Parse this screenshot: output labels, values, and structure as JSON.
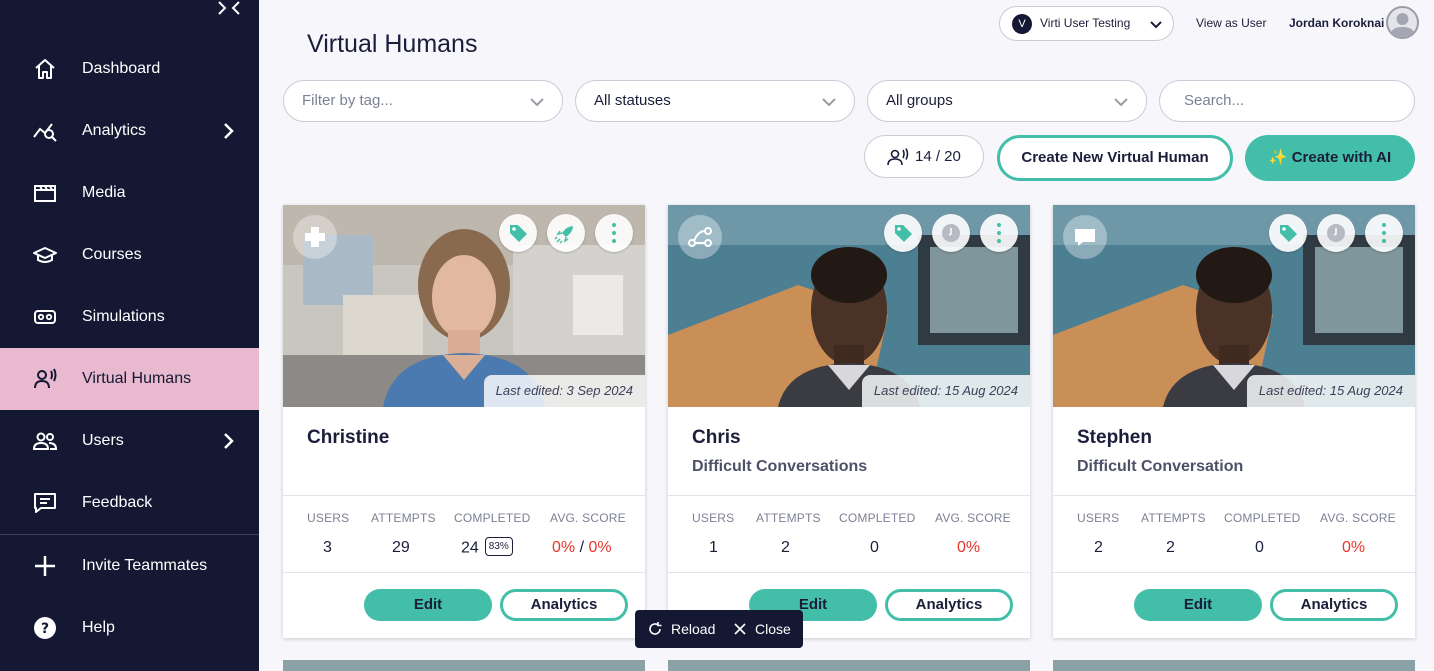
{
  "sidebar": {
    "items": [
      {
        "label": "Dashboard",
        "icon": "home-icon",
        "active": false,
        "expandable": false
      },
      {
        "label": "Analytics",
        "icon": "analytics-icon",
        "active": false,
        "expandable": true
      },
      {
        "label": "Media",
        "icon": "clapperboard-icon",
        "active": false,
        "expandable": false
      },
      {
        "label": "Courses",
        "icon": "graduation-cap-icon",
        "active": false,
        "expandable": false
      },
      {
        "label": "Simulations",
        "icon": "vr-headset-icon",
        "active": false,
        "expandable": false
      },
      {
        "label": "Virtual Humans",
        "icon": "speaking-person-icon",
        "active": true,
        "expandable": false
      },
      {
        "label": "Users",
        "icon": "users-icon",
        "active": false,
        "expandable": true
      },
      {
        "label": "Feedback",
        "icon": "chat-box-icon",
        "active": false,
        "expandable": false
      }
    ],
    "bottom_items": [
      {
        "label": "Invite Teammates",
        "icon": "plus-icon"
      },
      {
        "label": "Help",
        "icon": "help-icon"
      }
    ],
    "colors": {
      "background": "#141833",
      "active": "#e9b9cf"
    }
  },
  "header": {
    "title": "Virtual Humans",
    "org_logo_letter": "V",
    "org_name": "Virti User Testing",
    "view_as": "View as User",
    "user_name": "Jordan Koroknai"
  },
  "filters": {
    "tag_placeholder": "Filter by tag...",
    "status": "All statuses",
    "group": "All groups",
    "search_placeholder": "Search..."
  },
  "actions": {
    "seat_count": "14 / 20",
    "create_label": "Create New Virtual Human",
    "create_ai_label": "✨ Create with AI",
    "accent": "#43bfa9"
  },
  "stat_labels": {
    "users": "USERS",
    "attempts": "ATTEMPTS",
    "completed": "COMPLETED",
    "avg_score": "AVG. SCORE"
  },
  "cards": [
    {
      "name": "Christine",
      "subtitle": "",
      "type_icon": "medical-cross-icon",
      "status_icon": "rocket-icon",
      "last_edited": "Last edited:  3 Sep 2024",
      "users": "3",
      "attempts": "29",
      "completed": "24",
      "completed_pct": "83%",
      "avg_score_a": "0%",
      "avg_score_sep": "/",
      "avg_score_b": "0%",
      "edit_label": "Edit",
      "analytics_label": "Analytics"
    },
    {
      "name": "Chris",
      "subtitle": "Difficult Conversations",
      "type_icon": "branching-icon",
      "status_icon": "clock-icon",
      "last_edited": "Last edited:  15 Aug 2024",
      "users": "1",
      "attempts": "2",
      "completed": "0",
      "avg_score": "0%",
      "edit_label": "Edit",
      "analytics_label": "Analytics"
    },
    {
      "name": "Stephen",
      "subtitle": "Difficult Conversation",
      "type_icon": "speech-bubble-icon",
      "status_icon": "clock-icon",
      "last_edited": "Last edited:  15 Aug 2024",
      "users": "2",
      "attempts": "2",
      "completed": "0",
      "avg_score": "0%",
      "edit_label": "Edit",
      "analytics_label": "Analytics"
    }
  ],
  "toast": {
    "reload": "Reload",
    "close": "Close"
  }
}
